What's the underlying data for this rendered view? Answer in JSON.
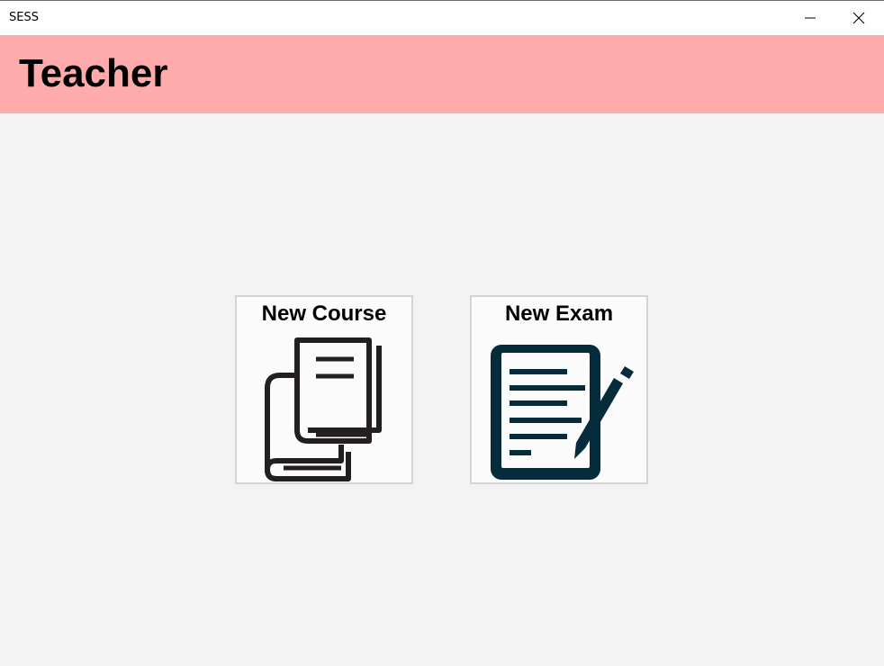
{
  "window": {
    "title": "SESS",
    "minimize_icon": "minimize-icon",
    "close_icon": "close-icon"
  },
  "header": {
    "title": "Teacher",
    "background": "#ffabab"
  },
  "actions": [
    {
      "label": "New Course",
      "icon": "books-icon"
    },
    {
      "label": "New Exam",
      "icon": "exam-document-icon"
    }
  ],
  "colors": {
    "course_icon": "#231f20",
    "exam_icon": "#062b3a"
  }
}
